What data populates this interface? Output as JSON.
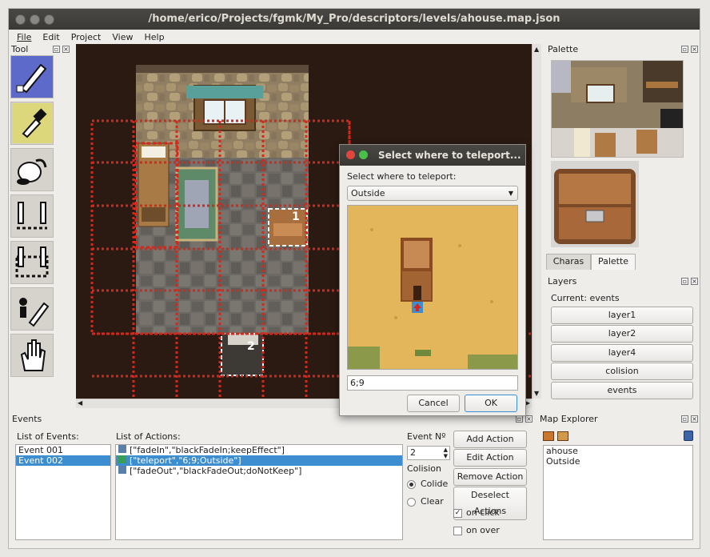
{
  "window": {
    "title": "/home/erico/Projects/fgmk/My_Pro/descriptors/levels/ahouse.map.json"
  },
  "menu": [
    "File",
    "Edit",
    "Project",
    "View",
    "Help"
  ],
  "tool_dock": {
    "title": "Tool"
  },
  "palette_dock": {
    "title": "Palette",
    "tabs": [
      "Charas",
      "Palette"
    ]
  },
  "layers_dock": {
    "title": "Layers",
    "current": "Current: events",
    "buttons": [
      "layer1",
      "layer2",
      "layer4",
      "colision",
      "events"
    ]
  },
  "events_dock": {
    "title": "Events",
    "list_label": "List of Events:",
    "events": [
      "Event 001",
      "Event 002"
    ],
    "selected_event": 1,
    "actions_label": "List of Actions:",
    "actions": [
      "[\"fadeIn\",\"blackFadeIn;keepEffect\"]",
      "[\"teleport\",\"6;9;Outside\"]",
      "[\"fadeOut\",\"blackFadeOut;doNotKeep\"]"
    ],
    "selected_action": 1,
    "event_no_label": "Event Nº",
    "event_no_value": "2",
    "colision_label": "Colision",
    "colide_label": "Colide",
    "clear_label": "Clear",
    "on_click_label": "on click",
    "on_over_label": "on over",
    "add_action": "Add Action",
    "edit_action": "Edit Action",
    "remove_action": "Remove Action",
    "deselect_actions": "Deselect Actions"
  },
  "map_explorer": {
    "title": "Map Explorer",
    "maps": [
      "ahouse",
      "Outside"
    ]
  },
  "map_markers": [
    "1",
    "2"
  ],
  "dialog": {
    "title": "Select where to teleport...",
    "label": "Select where to teleport:",
    "dropdown_value": "Outside",
    "coords_value": "6;9",
    "cancel": "Cancel",
    "ok": "OK"
  },
  "colors": {
    "accent": "#3d8ed0",
    "event_grid": "#d8261a",
    "sand": "#e3b65c"
  }
}
